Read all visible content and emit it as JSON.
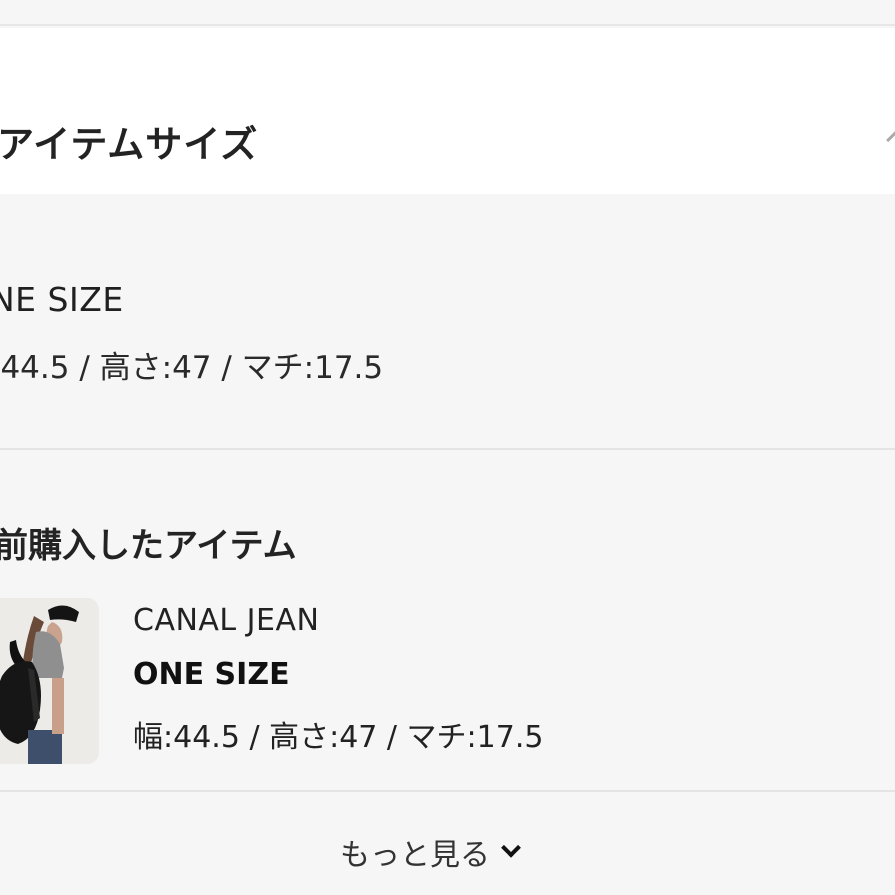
{
  "header": {
    "title": "アイテムサイズ"
  },
  "selected_size": {
    "name": "NE SIZE",
    "detail": ":44.5 / 高さ:47 / マチ:17.5"
  },
  "purchase_history": {
    "title": "前購入したアイテム",
    "item": {
      "brand": "CANAL JEAN",
      "size": "ONE SIZE",
      "detail": "幅:44.5 / 高さ:47 / マチ:17.5"
    }
  },
  "more": {
    "label": "もっと見る",
    "icon": "chevron-down-icon"
  }
}
